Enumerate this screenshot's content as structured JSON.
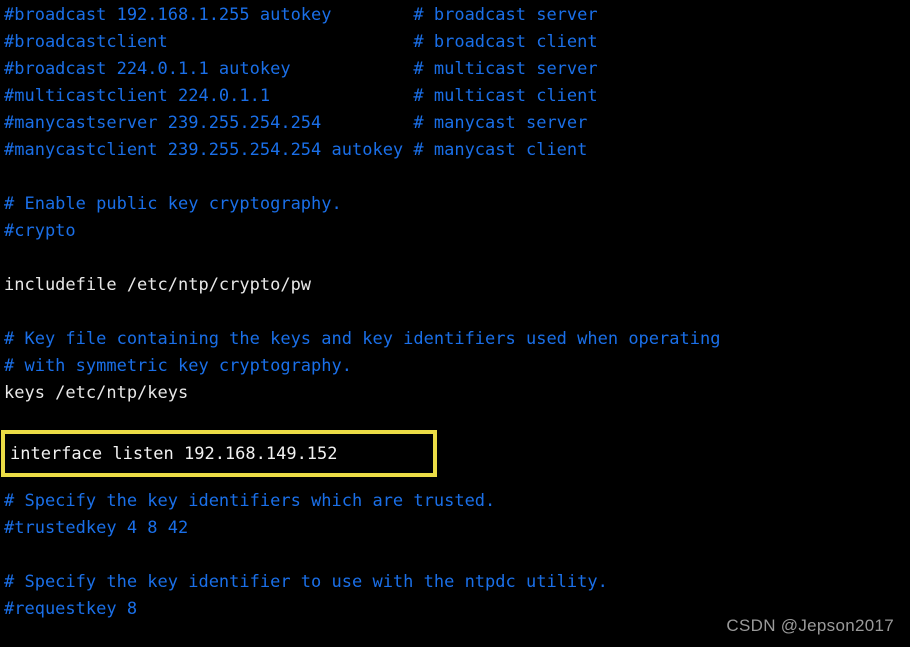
{
  "window": {
    "kind": "terminal-text-view",
    "background_color": "#000000",
    "comment_color": "#1a6fe8",
    "plain_text_color": "#e8e8e8",
    "highlight_border_color": "#ebdc45",
    "watermark_color": "#9a9a9a"
  },
  "file": {
    "lines": [
      {
        "text": "#broadcast 192.168.1.255 autokey        # broadcast server",
        "style": "comment"
      },
      {
        "text": "#broadcastclient                        # broadcast client",
        "style": "comment"
      },
      {
        "text": "#broadcast 224.0.1.1 autokey            # multicast server",
        "style": "comment"
      },
      {
        "text": "#multicastclient 224.0.1.1              # multicast client",
        "style": "comment"
      },
      {
        "text": "#manycastserver 239.255.254.254         # manycast server",
        "style": "comment"
      },
      {
        "text": "#manycastclient 239.255.254.254 autokey # manycast client",
        "style": "comment"
      },
      {
        "text": "",
        "style": "blank"
      },
      {
        "text": "# Enable public key cryptography.",
        "style": "comment"
      },
      {
        "text": "#crypto",
        "style": "comment"
      },
      {
        "text": "",
        "style": "blank"
      },
      {
        "text": "includefile /etc/ntp/crypto/pw",
        "style": "plain"
      },
      {
        "text": "",
        "style": "blank"
      },
      {
        "text": "# Key file containing the keys and key identifiers used when operating",
        "style": "comment"
      },
      {
        "text": "# with symmetric key cryptography.",
        "style": "comment"
      },
      {
        "text": "keys /etc/ntp/keys",
        "style": "plain"
      },
      {
        "text": "",
        "style": "blank"
      },
      {
        "text": "",
        "style": "blank"
      },
      {
        "text": "",
        "style": "blank"
      },
      {
        "text": "# Specify the key identifiers which are trusted.",
        "style": "comment"
      },
      {
        "text": "#trustedkey 4 8 42",
        "style": "comment"
      },
      {
        "text": "",
        "style": "blank"
      },
      {
        "text": "# Specify the key identifier to use with the ntpdc utility.",
        "style": "comment"
      },
      {
        "text": "#requestkey 8",
        "style": "comment"
      }
    ]
  },
  "highlight": {
    "text": "interface listen 192.168.149.152",
    "border_color": "#ebdc45"
  },
  "watermark": {
    "text": "CSDN @Jepson2017"
  }
}
